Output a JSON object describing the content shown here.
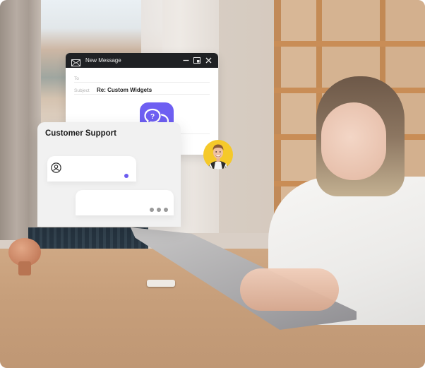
{
  "email_window": {
    "title": "New Message",
    "icons": {
      "mail": "envelope-icon",
      "minimize": "minimize-icon",
      "maximize": "maximize-icon",
      "close": "close-icon"
    },
    "fields": {
      "to_label": "To",
      "to_value": "",
      "subject_label": "Subject",
      "subject_value": "Re: Custom Widgets"
    }
  },
  "support_widget": {
    "title": "Customer Support",
    "incoming_message": {
      "icon": "user-circle-icon",
      "unread": true
    },
    "outgoing_message": {
      "typing_indicator": "three-dots"
    }
  },
  "chat_badge": {
    "icon": "question-chat-bubbles-icon",
    "color": "#6e5ff2"
  },
  "agent_avatar": {
    "background_color": "#f5c92a"
  },
  "colors": {
    "accent": "#6b5cf0",
    "titlebar": "#1f2124",
    "widget_background": "#f1f1f1"
  }
}
